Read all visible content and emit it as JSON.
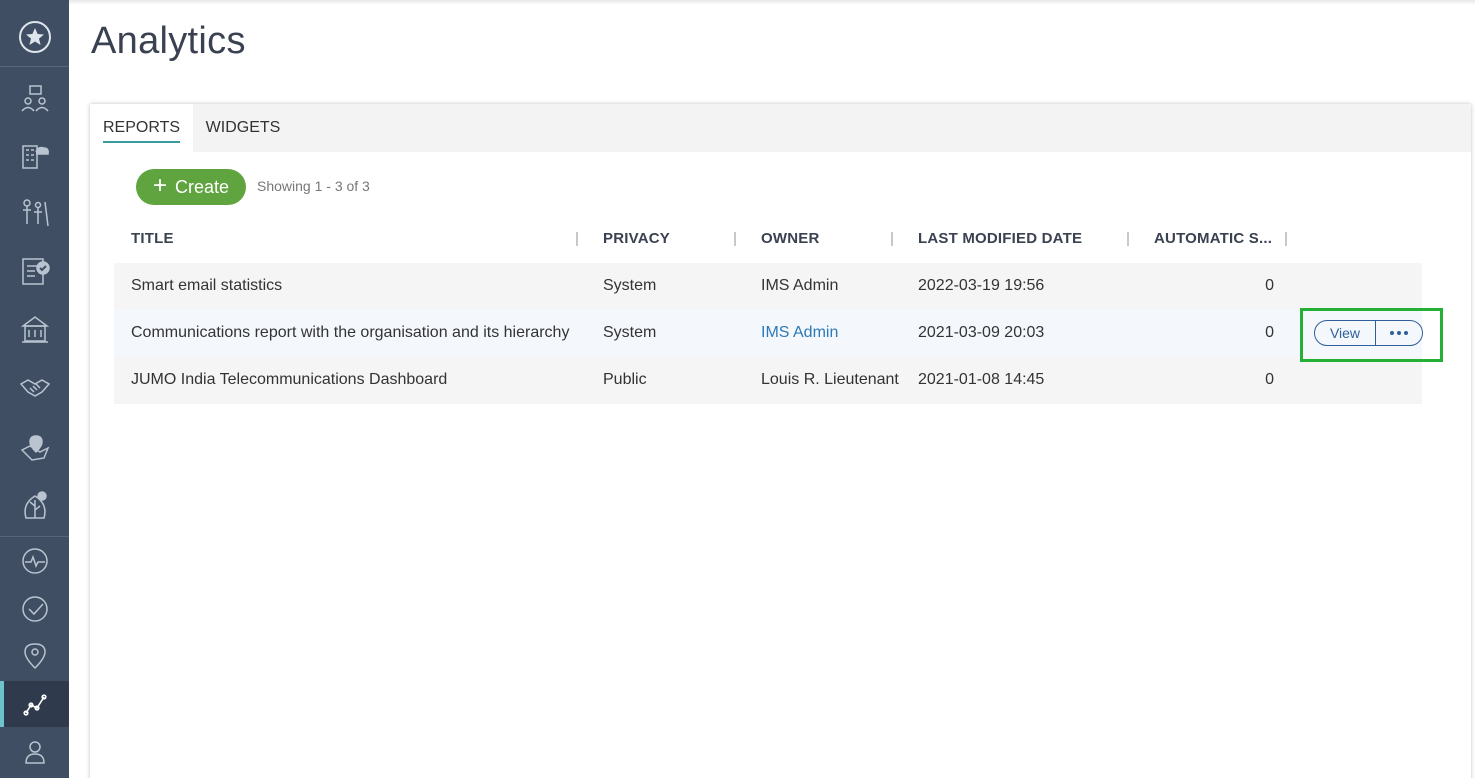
{
  "page": {
    "title": "Analytics"
  },
  "sidebar": {
    "items": [
      {
        "icon": "star-icon"
      },
      {
        "icon": "people-map-icon"
      },
      {
        "icon": "building-cloud-icon"
      },
      {
        "icon": "family-icon"
      },
      {
        "icon": "checklist-icon"
      },
      {
        "icon": "institution-icon"
      },
      {
        "icon": "handshake-icon"
      },
      {
        "icon": "region-pin-icon"
      },
      {
        "icon": "plant-icon"
      },
      {
        "icon": "activity-icon"
      },
      {
        "icon": "check-circle-icon"
      },
      {
        "icon": "location-pin-icon"
      },
      {
        "icon": "analytics-icon",
        "active": true
      },
      {
        "icon": "user-icon"
      }
    ]
  },
  "tabs": {
    "reports": "REPORTS",
    "widgets": "WIDGETS"
  },
  "toolbar": {
    "create_label": "Create",
    "showing": "Showing 1 - 3 of 3"
  },
  "table": {
    "headers": {
      "title": "TITLE",
      "privacy": "PRIVACY",
      "owner": "OWNER",
      "modified": "LAST MODIFIED DATE",
      "automatic": "AUTOMATIC S..."
    },
    "rows": [
      {
        "title": "Smart email statistics",
        "privacy": "System",
        "owner": "IMS Admin",
        "modified": "2022-03-19 19:56",
        "automatic": "0"
      },
      {
        "title": "Communications report with the organisation and its hierarchy",
        "privacy": "System",
        "owner": "IMS Admin",
        "modified": "2021-03-09 20:03",
        "automatic": "0"
      },
      {
        "title": "JUMO India Telecommunications Dashboard",
        "privacy": "Public",
        "owner": "Louis R. Lieutenant",
        "modified": "2021-01-08 14:45",
        "automatic": "0"
      }
    ],
    "row_actions": {
      "view_label": "View"
    }
  },
  "colors": {
    "sidebar": "#3f4e63",
    "accent": "#5fa43f",
    "link": "#2e79b5",
    "highlight": "#23b035"
  }
}
